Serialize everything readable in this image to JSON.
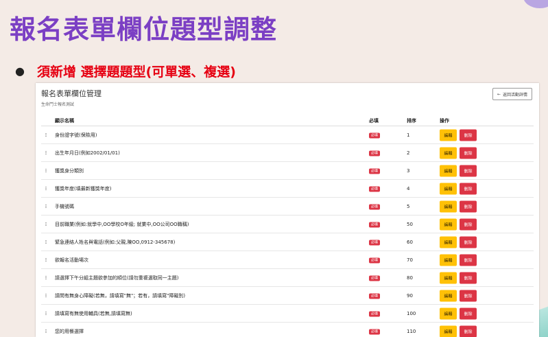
{
  "slide": {
    "title": "報名表單欄位題型調整",
    "bullet": "須新增 選擇題題型(可單選、複選)"
  },
  "panel": {
    "title": "報名表單欄位管理",
    "subtitle": "生命鬥士報名測試",
    "back_label": "返回活動詳情"
  },
  "table": {
    "headers": {
      "name": "顯示名稱",
      "required": "必填",
      "order": "排序",
      "ops": "操作"
    },
    "rows": [
      {
        "name": "身份證字號(保險用)",
        "required": "必填",
        "order": "1",
        "edit": "編輯",
        "delete": "刪除"
      },
      {
        "name": "出生年月日(例如2002/01/01)",
        "required": "必填",
        "order": "2",
        "edit": "編輯",
        "delete": "刪除"
      },
      {
        "name": "獲獎身分類別",
        "required": "必填",
        "order": "3",
        "edit": "編輯",
        "delete": "刪除"
      },
      {
        "name": "獲獎年度(填最新獲獎年度)",
        "required": "必填",
        "order": "4",
        "edit": "編輯",
        "delete": "刪除"
      },
      {
        "name": "手機號碼",
        "required": "必填",
        "order": "5",
        "edit": "編輯",
        "delete": "刪除"
      },
      {
        "name": "目前職業(例如:就學中,OO學校O年級; 就業中,OO公司OO職稱)",
        "required": "必填",
        "order": "50",
        "edit": "編輯",
        "delete": "刪除"
      },
      {
        "name": "緊急連絡人姓名與電話(例如:父親,陳OO,0912-345678)",
        "required": "必填",
        "order": "60",
        "edit": "編輯",
        "delete": "刪除"
      },
      {
        "name": "欲報名活動場次",
        "required": "必填",
        "order": "70",
        "edit": "編輯",
        "delete": "刪除"
      },
      {
        "name": "請選擇下午分組主題欲參加的順位(請勿重複選取同一主題)",
        "required": "必填",
        "order": "80",
        "edit": "編輯",
        "delete": "刪除"
      },
      {
        "name": "請問有無身心障礙(若無，請填寫\"無\"；若有，請填寫\"障礙別)",
        "required": "必填",
        "order": "90",
        "edit": "編輯",
        "delete": "刪除"
      },
      {
        "name": "請填寫有無使用輔具(若無,請填寫無)",
        "required": "必填",
        "order": "100",
        "edit": "編輯",
        "delete": "刪除"
      },
      {
        "name": "您的用餐選擇",
        "required": "必填",
        "order": "110",
        "edit": "編輯",
        "delete": "刪除"
      }
    ]
  },
  "colors": {
    "title": "#7b3fc4",
    "bullet": "#e60012",
    "edit_button": "#ffc107",
    "delete_button": "#dc3545",
    "required_badge": "#dc3545"
  }
}
